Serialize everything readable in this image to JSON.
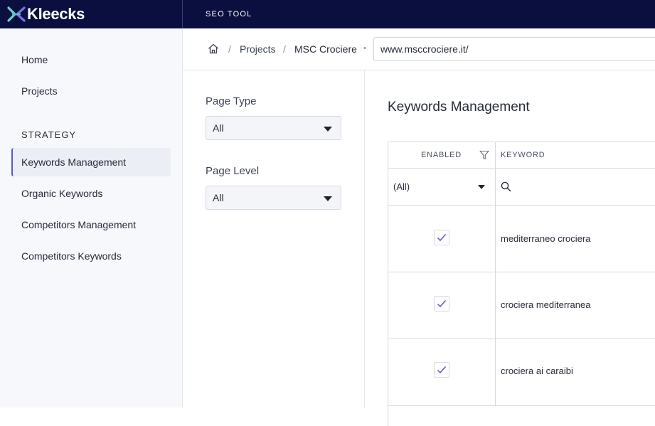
{
  "header": {
    "logo_text": "Kleecks",
    "app_name": "SEO TOOL",
    "brand_color": "#0b0f3f",
    "accent_color": "#5b55d6"
  },
  "sidebar": {
    "top_links": [
      "Home",
      "Projects"
    ],
    "section_title": "STRATEGY",
    "items": [
      {
        "label": "Keywords Management",
        "active": true
      },
      {
        "label": "Organic Keywords",
        "active": false
      },
      {
        "label": "Competitors Management",
        "active": false
      },
      {
        "label": "Competitors Keywords",
        "active": false
      }
    ]
  },
  "breadcrumb": {
    "home_icon": "home-icon",
    "items": [
      "Projects",
      "MSC Crociere"
    ],
    "separator": "/",
    "dot": "•",
    "url_value": "www.msccrociere.it/"
  },
  "filters": {
    "page_type": {
      "label": "Page Type",
      "value": "All"
    },
    "page_level": {
      "label": "Page Level",
      "value": "All"
    }
  },
  "main": {
    "title": "Keywords Management",
    "columns": {
      "enabled": "ENABLED",
      "keyword": "KEYWORD"
    },
    "enabled_filter_value": "(All)",
    "rows": [
      {
        "enabled": true,
        "keyword": "mediterraneo crociera"
      },
      {
        "enabled": true,
        "keyword": "crociera mediterranea"
      },
      {
        "enabled": true,
        "keyword": "crociera ai caraibi"
      }
    ]
  }
}
